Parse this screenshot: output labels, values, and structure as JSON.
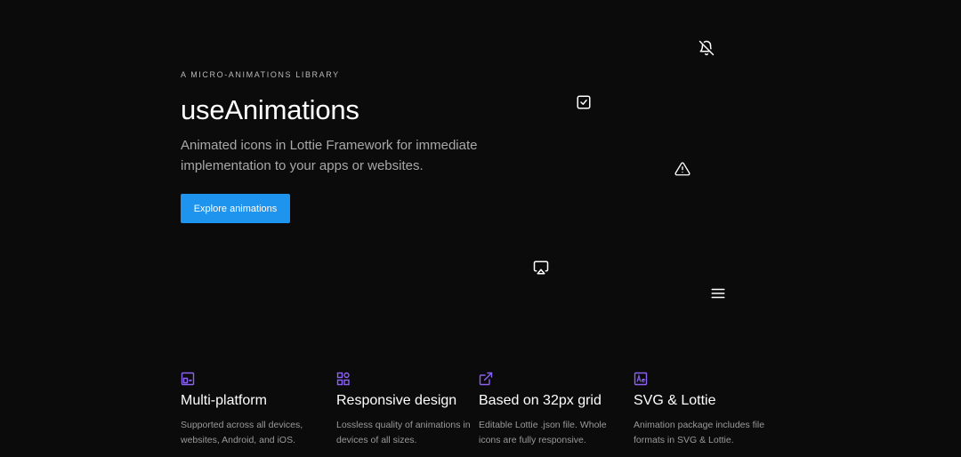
{
  "hero": {
    "eyebrow": "A MICRO-ANIMATIONS LIBRARY",
    "title": "useAnimations",
    "subtitle": "Animated icons in Lottie Framework for immediate implementation to your apps or websites.",
    "cta_label": "Explore animations"
  },
  "floating_icons": [
    "bell-off-icon",
    "checkbox-icon",
    "warning-icon",
    "airplay-icon",
    "menu-icon"
  ],
  "features": [
    {
      "icon": "multi-platform-icon",
      "title": "Multi-platform",
      "description": "Supported across all devices, websites, Android, and iOS."
    },
    {
      "icon": "grid-icon",
      "title": "Responsive design",
      "description": "Lossless quality of animations in devices of all sizes."
    },
    {
      "icon": "external-link-icon",
      "title": "Based on 32px grid",
      "description": "Editable Lottie .json file. Whole icons are fully responsive."
    },
    {
      "icon": "ae-icon",
      "title": "SVG & Lottie",
      "description": "Animation package includes file formats in SVG & Lottie."
    }
  ],
  "colors": {
    "background": "#0b0b0c",
    "accent": "#1e94ef",
    "feature_icon": "#8a63f2",
    "muted_text": "#a8a8a8"
  }
}
